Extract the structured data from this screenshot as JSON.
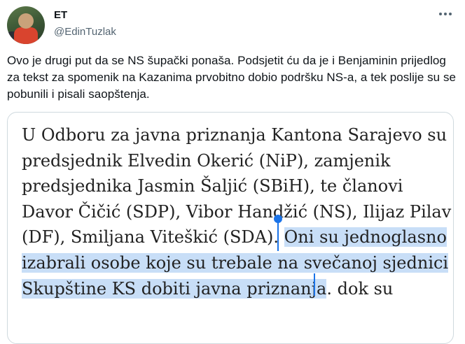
{
  "tweet": {
    "author_name": "ET",
    "author_handle": "@EdinTuzlak",
    "text": "Ovo je drugi put da se NS šupački ponaša. Podsjetit ću da je i Benjaminin prijedlog za tekst za spomenik na Kazanima prvobitno dobio podršku NS-a, a tek poslije su se pobunili i pisali saopštenja.",
    "icons": {
      "more": "more-horizontal-icon",
      "avatar": "user-avatar"
    }
  },
  "media": {
    "lines": [
      {
        "plain": "U Odboru za javna priznanja Kantona Sarajevo su",
        "highlight": ""
      },
      {
        "plain": "predsjednik Elvedin Okerić (NiP), zamjenik",
        "highlight": ""
      },
      {
        "plain": "predsjednika Jasmin Šaljić (SBiH), te članovi",
        "highlight": ""
      },
      {
        "plain": "Davor Čičić (SDP), Vibor Handžić (NS), Ilijaz Pilav",
        "highlight": ""
      },
      {
        "plain": "(DF), Smiljana Viteškić (SDA). ",
        "highlight": "Oni su jednoglasno"
      },
      {
        "plain": "",
        "highlight": "izabrali osobe koje su trebale na svečanoj sjednici"
      },
      {
        "plain": ". dok su",
        "highlight": "Skupštine KS dobiti javna priznanja"
      }
    ],
    "selection_color": "#c8def7",
    "handle_color": "#1a73e8"
  }
}
